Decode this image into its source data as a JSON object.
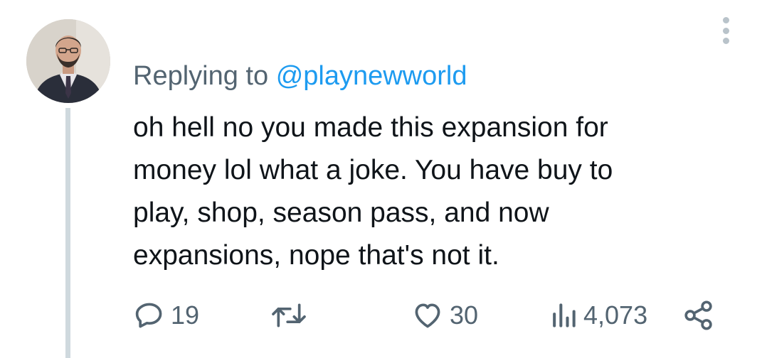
{
  "reply_context": {
    "prefix": "Replying to",
    "handle": "@playnewworld"
  },
  "tweet": {
    "text_lines": [
      "oh hell no you made this expansion for",
      "money lol what a joke. You have buy to",
      "play, shop, season pass, and now",
      "expansions, nope that's not it."
    ]
  },
  "actions": {
    "reply_count": "19",
    "retweet_count": "",
    "like_count": "30",
    "view_count": "4,073"
  },
  "icons": {
    "reply": "speech-bubble-icon",
    "retweet": "retweet-arrows-icon",
    "like": "heart-icon",
    "views": "bar-chart-icon",
    "share": "share-nodes-icon",
    "more": "vertical-ellipsis-icon"
  },
  "colors": {
    "text": "#0f1419",
    "secondary": "#536471",
    "link": "#1d9bf0",
    "thread_line": "#cfd9de"
  }
}
